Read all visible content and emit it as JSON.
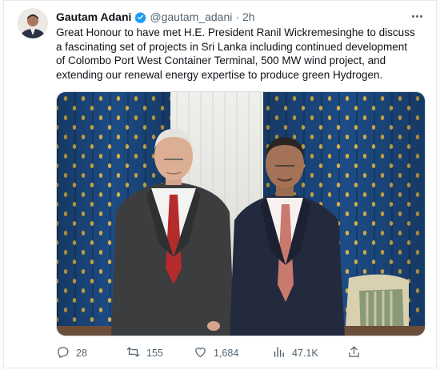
{
  "tweet": {
    "author_name": "Gautam Adani",
    "handle": "@gautam_adani",
    "separator": "·",
    "time": "2h",
    "text_lines": [
      "Great Honour to have met H.E. President Ranil Wickremesinghe to discuss",
      "a fascinating set of projects in Sri Lanka including continued development",
      "of Colombo Port West Container Terminal, 500 MW wind project, and",
      "extending our renewal energy expertise to produce green Hydrogen."
    ]
  },
  "actions": {
    "replies": "28",
    "retweets": "155",
    "likes": "1,684",
    "views": "47.1K"
  },
  "icons": {
    "verified": "verified-badge-icon",
    "more": "more-horizontal-icon",
    "reply": "reply-icon",
    "retweet": "retweet-icon",
    "like": "heart-icon",
    "views": "views-chart-icon",
    "share": "share-icon"
  },
  "colors": {
    "verified_blue": "#1d9bf0",
    "text": "#0f1419",
    "secondary": "#536471",
    "curtain_blue": "#1f4d8a"
  }
}
